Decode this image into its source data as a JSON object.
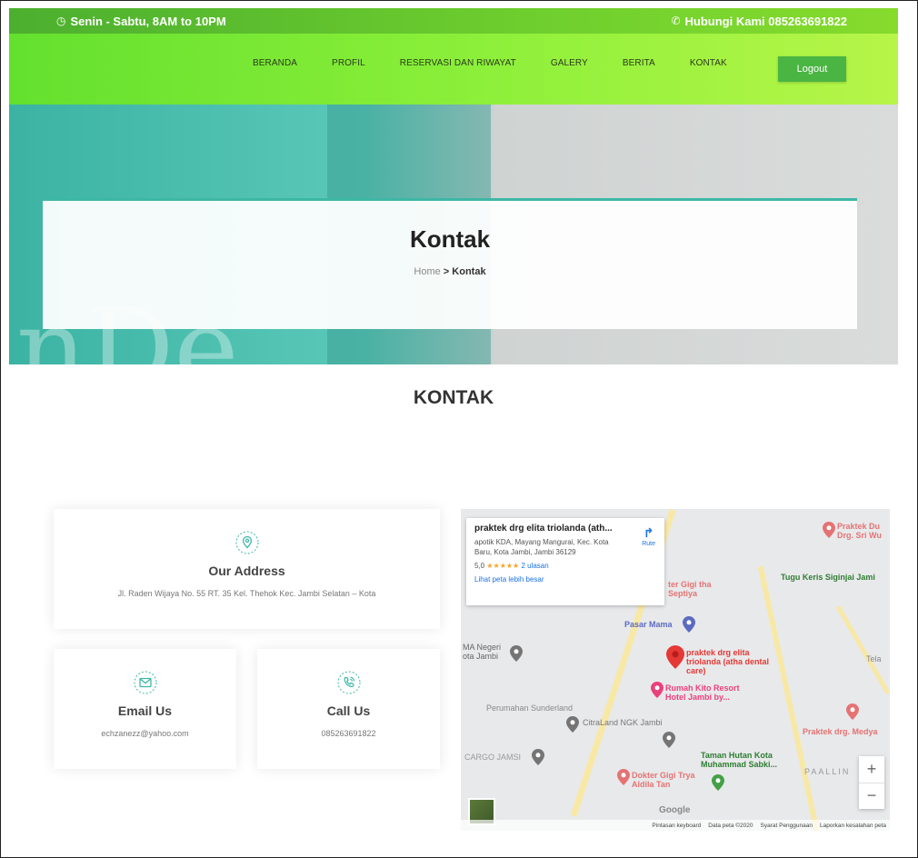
{
  "topbar": {
    "hours": "Senin - Sabtu, 8AM to 10PM",
    "contact": "Hubungi Kami 085263691822"
  },
  "nav": {
    "items": [
      "BERANDA",
      "PROFIL",
      "RESERVASI DAN RIWAYAT",
      "GALERY",
      "BERITA",
      "KONTAK"
    ],
    "logout": "Logout"
  },
  "hero": {
    "title": "Kontak",
    "crumb_home": "Home",
    "crumb_sep": " > ",
    "crumb_current": "Kontak"
  },
  "section": {
    "title": "KONTAK"
  },
  "address": {
    "title": "Our Address",
    "text": "Jl. Raden Wijaya No. 55 RT. 35 Kel. Thehok Kec. Jambi Selatan – Kota"
  },
  "email": {
    "title": "Email Us",
    "text": "echzanezz@yahoo.com"
  },
  "phone": {
    "title": "Call Us",
    "text": "085263691822"
  },
  "map": {
    "popup_title": "praktek drg elita triolanda (ath...",
    "popup_address": "apotik KDA, Mayang Mangurai, Kec. Kota Baru, Kota Jambi, Jambi 36129",
    "route_label": "Rute",
    "rating": "5,0",
    "stars": "★★★★★",
    "reviews": "2 ulasan",
    "larger_map": "Lihat peta lebih besar",
    "labels": {
      "praktek_du": "Praktek Du Drg. Sri Wu",
      "tugu": "Tugu Keris Siginjai Jami",
      "gigi_septiya": "ter Gigi tha Septiya",
      "pasar_mama": "Pasar Mama",
      "ma_negeri": "MA Negeri ota Jambi",
      "main_pin": "praktek drg elita triolanda (atha dental care)",
      "tela": "Tela",
      "rumah_kito": "Rumah Kito Resort Hotel Jambi by...",
      "perumahan": "Perumahan Sunderland",
      "citraland": "CitraLand NGK Jambi",
      "praktek_medya": "Praktek drg. Medya",
      "cargo": "CARGO JAMSI",
      "taman": "Taman Hutan Kota Muhammad Sabki...",
      "paallin": "PAALLIN",
      "dokter_gigi": "Dokter Gigi Trya Aldila Tan"
    },
    "google": "Google",
    "footer": [
      "Pintasan keyboard",
      "Data peta ©2020",
      "Syarat Penggunaan",
      "Laporkan kesalahan peta"
    ],
    "zoom_in": "+",
    "zoom_out": "−"
  },
  "colors": {
    "accent": "#3db7a6",
    "nav_green": "#63e02e",
    "logout": "#4bb543",
    "pin_red": "#e53935"
  }
}
